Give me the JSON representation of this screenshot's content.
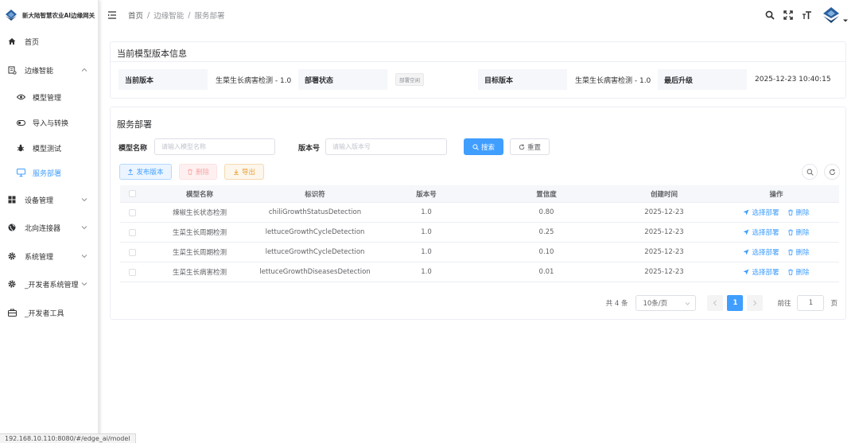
{
  "app": {
    "title": "新大陆智慧农业AI边缘网关"
  },
  "sidebar": {
    "items": [
      {
        "label": "首页",
        "icon": "home-icon"
      },
      {
        "label": "边缘智能",
        "icon": "edge-icon",
        "expanded": true
      },
      {
        "label": "模型管理",
        "icon": "eye-icon"
      },
      {
        "label": "导入与转换",
        "icon": "toggle-icon"
      },
      {
        "label": "模型测试",
        "icon": "bug-icon"
      },
      {
        "label": "服务部署",
        "icon": "monitor-icon",
        "active": true
      },
      {
        "label": "设备管理",
        "icon": "grid-icon"
      },
      {
        "label": "北向连接器",
        "icon": "globe-icon"
      },
      {
        "label": "系统管理",
        "icon": "gear-icon"
      },
      {
        "label": "_开发者系统管理",
        "icon": "gear-icon"
      },
      {
        "label": "_开发者工具",
        "icon": "toolbox-icon"
      }
    ]
  },
  "header": {
    "breadcrumb": [
      "首页",
      "边缘智能",
      "服务部署"
    ]
  },
  "info": {
    "title": "当前模型版本信息",
    "current_version_label": "当前版本",
    "current_version_value": "生菜生长病害检测 - 1.0",
    "deploy_status_label": "部署状态",
    "deploy_status_value": "部署空闲",
    "target_version_label": "目标版本",
    "target_version_value": "生菜生长病害检测 - 1.0",
    "last_upgrade_label": "最后升级",
    "last_upgrade_value": "2025-12-23 10:40:15"
  },
  "deploy": {
    "title": "服务部署",
    "model_name_label": "模型名称",
    "model_name_placeholder": "请输入模型名称",
    "version_label": "版本号",
    "version_placeholder": "请输入版本号",
    "search_label": "搜索",
    "reset_label": "重置",
    "publish_label": "发布版本",
    "delete_label": "删除",
    "export_label": "导出"
  },
  "table": {
    "headers": [
      "模型名称",
      "标识符",
      "版本号",
      "置信度",
      "创建时间",
      "操作"
    ],
    "op_deploy": "选择部署",
    "op_delete": "删除",
    "rows": [
      {
        "name": "辣椒生长状态检测",
        "id": "chiliGrowthStatusDetection",
        "version": "1.0",
        "confidence": "0.80",
        "created": "2025-12-23"
      },
      {
        "name": "生菜生长周期检测",
        "id": "lettuceGrowthCycleDetection",
        "version": "1.0",
        "confidence": "0.25",
        "created": "2025-12-23"
      },
      {
        "name": "生菜生长周期检测",
        "id": "lettuceGrowthCycleDetection",
        "version": "1.0",
        "confidence": "0.10",
        "created": "2025-12-23"
      },
      {
        "name": "生菜生长病害检测",
        "id": "lettuceGrowthDiseasesDetection",
        "version": "1.0",
        "confidence": "0.01",
        "created": "2025-12-23"
      }
    ]
  },
  "pagination": {
    "total": "共 4 条",
    "page_size": "10条/页",
    "current_page": "1",
    "goto_label": "前往",
    "goto_value": "1",
    "page_suffix": "页"
  },
  "status_bar": {
    "url": "192.168.10.110:8080/#/edge_ai/model"
  },
  "colors": {
    "primary": "#409eff",
    "danger": "#f56c6c",
    "warning": "#e6a23c"
  }
}
